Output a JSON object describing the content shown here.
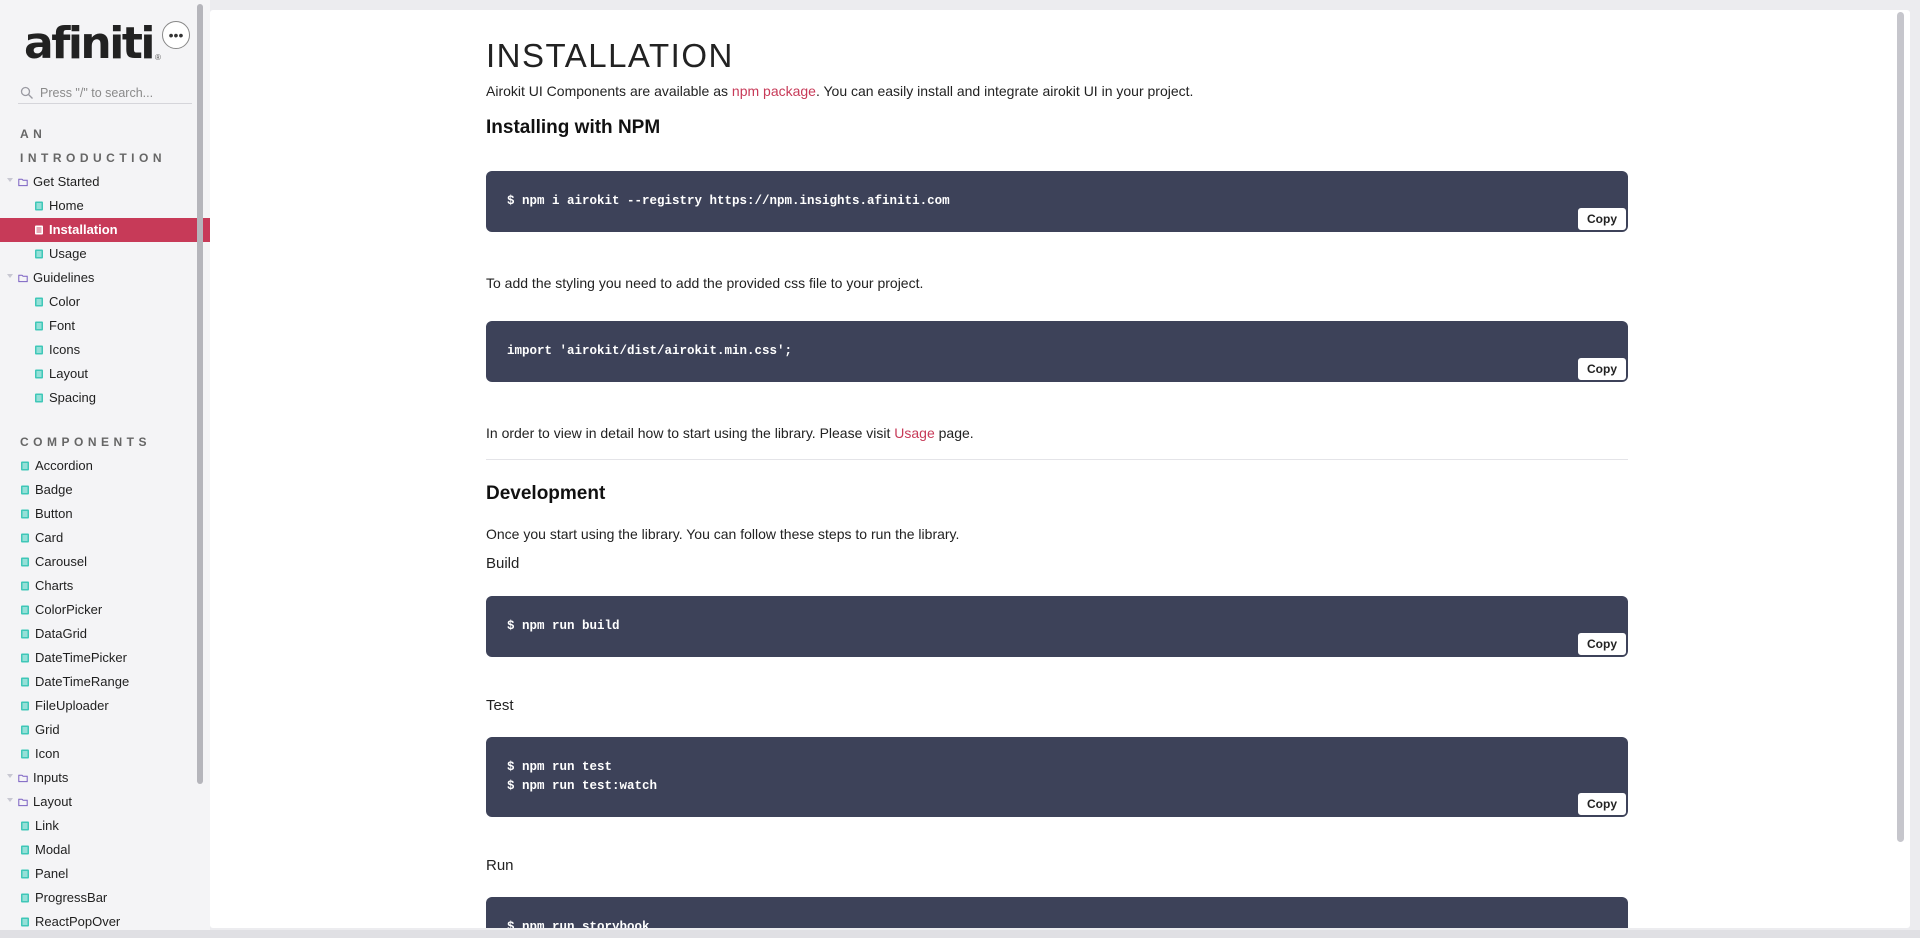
{
  "sidebar": {
    "logo": "afiniti",
    "logo_mark": "®",
    "menu_icon": "ellipsis-icon",
    "search_placeholder": "Press \"/\" to search...",
    "sections": [
      {
        "title": "AN",
        "title2": "INTRODUCTION"
      },
      {
        "title": "COMPONENTS"
      }
    ],
    "intro_items": [
      {
        "label": "Get Started",
        "type": "folder"
      },
      {
        "label": "Home",
        "type": "child"
      },
      {
        "label": "Installation",
        "type": "child",
        "active": true
      },
      {
        "label": "Usage",
        "type": "child"
      },
      {
        "label": "Guidelines",
        "type": "folder"
      },
      {
        "label": "Color",
        "type": "child"
      },
      {
        "label": "Font",
        "type": "child"
      },
      {
        "label": "Icons",
        "type": "child"
      },
      {
        "label": "Layout",
        "type": "child"
      },
      {
        "label": "Spacing",
        "type": "child"
      }
    ],
    "component_items": [
      {
        "label": "Accordion",
        "type": "doc"
      },
      {
        "label": "Badge",
        "type": "doc"
      },
      {
        "label": "Button",
        "type": "doc"
      },
      {
        "label": "Card",
        "type": "doc"
      },
      {
        "label": "Carousel",
        "type": "doc"
      },
      {
        "label": "Charts",
        "type": "doc"
      },
      {
        "label": "ColorPicker",
        "type": "doc"
      },
      {
        "label": "DataGrid",
        "type": "doc"
      },
      {
        "label": "DateTimePicker",
        "type": "doc"
      },
      {
        "label": "DateTimeRange",
        "type": "doc"
      },
      {
        "label": "FileUploader",
        "type": "doc"
      },
      {
        "label": "Grid",
        "type": "doc"
      },
      {
        "label": "Icon",
        "type": "doc"
      },
      {
        "label": "Inputs",
        "type": "folder"
      },
      {
        "label": "Layout",
        "type": "folder"
      },
      {
        "label": "Link",
        "type": "doc"
      },
      {
        "label": "Modal",
        "type": "doc"
      },
      {
        "label": "Panel",
        "type": "doc"
      },
      {
        "label": "ProgressBar",
        "type": "doc"
      },
      {
        "label": "ReactPopOver",
        "type": "doc"
      }
    ]
  },
  "main": {
    "title": "INSTALLATION",
    "intro": {
      "before": "Airokit UI Components are available as ",
      "link": "npm package",
      "after": ". You can easily install and integrate airokit UI in your project."
    },
    "install_heading": "Installing with NPM",
    "code_install": "$ npm i airokit --registry https://npm.insights.afiniti.com",
    "styling_text": "To add the styling you need to add the provided css file to your project.",
    "code_css": "import 'airokit/dist/airokit.min.css';",
    "usage_text": {
      "before": "In order to view in detail how to start using the library. Please visit ",
      "link": "Usage",
      "after": " page."
    },
    "dev_heading": "Development",
    "dev_text": "Once you start using the library. You can follow these steps to run the library.",
    "build_label": "Build",
    "code_build": "$ npm run build",
    "test_label": "Test",
    "code_test": "$ npm run test\n$ npm run test:watch",
    "run_label": "Run",
    "code_run": "$ npm run storybook",
    "copy_label": "Copy"
  },
  "colors": {
    "accent": "#c73a58",
    "code_bg": "#3d4259",
    "file_icon": "#3fc7b8",
    "folder_icon": "#7a5fc2"
  }
}
